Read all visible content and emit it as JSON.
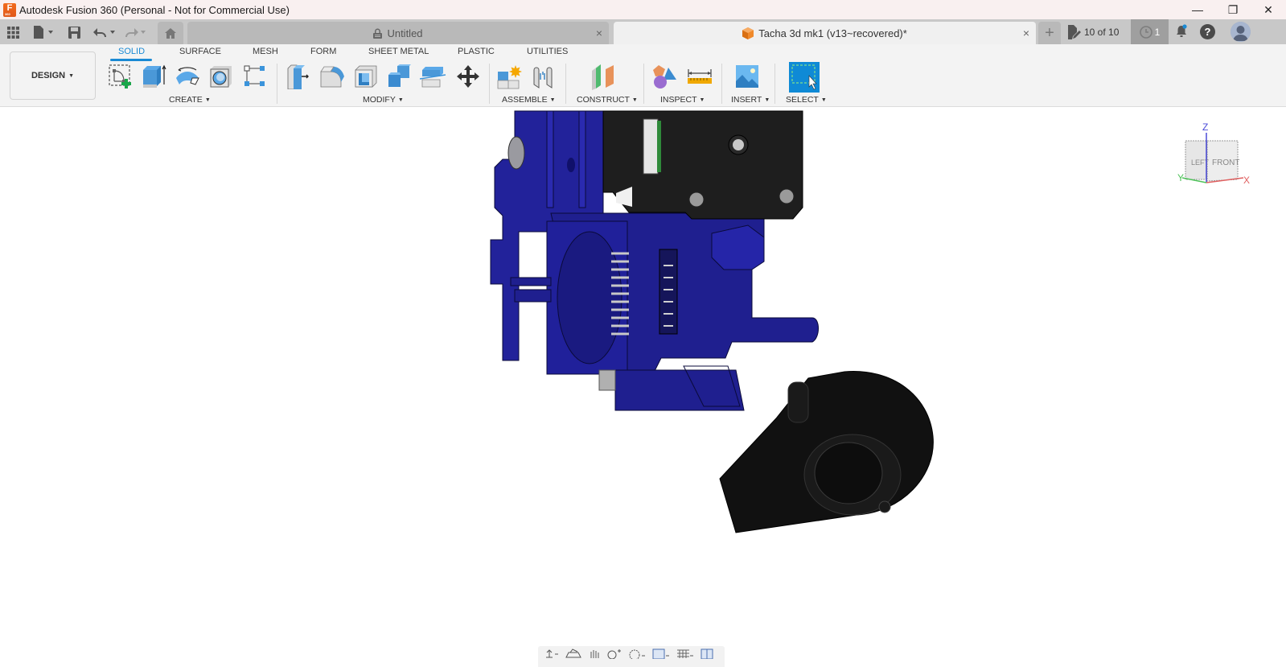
{
  "window": {
    "title": "Autodesk Fusion 360 (Personal - Not for Commercial Use)",
    "app_logo_letter": "F",
    "app_logo_sub": "360",
    "controls": {
      "minimize": "—",
      "restore": "❐",
      "close": "✕"
    }
  },
  "tabbar": {
    "tabs": [
      {
        "label": "Untitled",
        "icon": "lock-icon",
        "active": false,
        "close": "×"
      },
      {
        "label": "Tacha 3d mk1 (v13~recovered)*",
        "icon": "component-cube-icon",
        "active": true,
        "close": "×"
      }
    ],
    "new_tab": "+",
    "version_label": "10 of 10",
    "jobs_count": "1",
    "help": "?"
  },
  "ribbon": {
    "workspace": "DESIGN",
    "tabs": [
      "SOLID",
      "SURFACE",
      "MESH",
      "FORM",
      "SHEET METAL",
      "PLASTIC",
      "UTILITIES"
    ],
    "active_tab": "SOLID",
    "groups": [
      {
        "label": "CREATE",
        "tools": [
          "create-sketch",
          "extrude",
          "revolve",
          "hole",
          "pattern"
        ]
      },
      {
        "label": "MODIFY",
        "tools": [
          "press-pull",
          "fillet",
          "shell",
          "combine",
          "split-body",
          "move-copy"
        ]
      },
      {
        "label": "ASSEMBLE",
        "tools": [
          "new-component",
          "joint"
        ]
      },
      {
        "label": "CONSTRUCT",
        "tools": [
          "offset-plane"
        ]
      },
      {
        "label": "INSPECT",
        "tools": [
          "interference",
          "measure"
        ]
      },
      {
        "label": "INSERT",
        "tools": [
          "insert-image"
        ]
      },
      {
        "label": "SELECT",
        "tools": [
          "window-select"
        ]
      }
    ]
  },
  "viewcube": {
    "faces": {
      "left": "LEFT",
      "front": "FRONT"
    },
    "axes": {
      "z": "Z",
      "y": "Y",
      "x": "X"
    }
  },
  "colors": {
    "accent": "#1a8ad4",
    "model_blue": "#1f1f8f",
    "model_black": "#1c1c1c",
    "select_blue": "#0f8ad6"
  },
  "navbar": {
    "items": [
      "orbit",
      "look-at",
      "pan",
      "zoom",
      "fit",
      "display-settings",
      "grid-snaps",
      "viewports"
    ]
  }
}
